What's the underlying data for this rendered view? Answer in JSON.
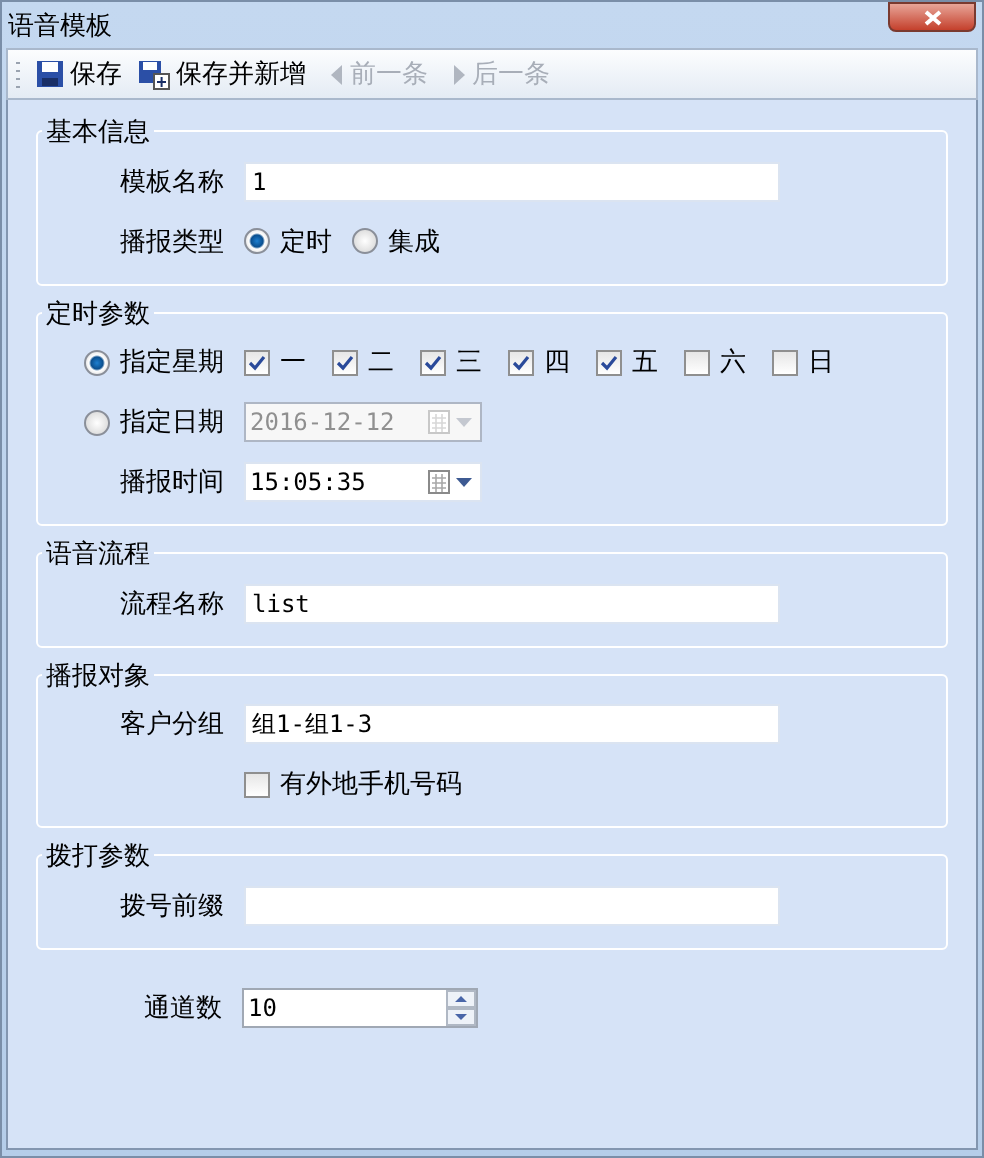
{
  "window": {
    "title": "语音模板"
  },
  "toolbar": [
    {
      "label": "保存",
      "kind": "save",
      "disabled": false
    },
    {
      "label": "保存并新增",
      "kind": "save-new",
      "disabled": false
    },
    {
      "label": "前一条",
      "kind": "prev",
      "disabled": true
    },
    {
      "label": "后一条",
      "kind": "next",
      "disabled": true
    }
  ],
  "groups": [
    {
      "title": "基本信息",
      "rows": [
        {
          "kind": "text",
          "label": "模板名称",
          "value": "1"
        },
        {
          "kind": "radio",
          "label": "播报类型",
          "options": [
            {
              "label": "定时",
              "selected": true
            },
            {
              "label": "集成",
              "selected": false
            }
          ]
        }
      ]
    },
    {
      "title": "定时参数",
      "rows": [
        {
          "kind": "weekdays",
          "label": "指定星期",
          "selected": true,
          "days": [
            {
              "label": "一",
              "checked": true
            },
            {
              "label": "二",
              "checked": true
            },
            {
              "label": "三",
              "checked": true
            },
            {
              "label": "四",
              "checked": true
            },
            {
              "label": "五",
              "checked": true
            },
            {
              "label": "六",
              "checked": false
            },
            {
              "label": "日",
              "checked": false
            }
          ]
        },
        {
          "kind": "date",
          "label": "指定日期",
          "selected": false,
          "value": "2016-12-12",
          "disabled": true
        },
        {
          "kind": "time",
          "label": "播报时间",
          "value": "15:05:35",
          "disabled": false
        }
      ]
    },
    {
      "title": "语音流程",
      "rows": [
        {
          "kind": "text",
          "label": "流程名称",
          "value": "list"
        }
      ]
    },
    {
      "title": "播报对象",
      "rows": [
        {
          "kind": "text",
          "label": "客户分组",
          "value": "组1-组1-3"
        },
        {
          "kind": "checkbox",
          "label": "有外地手机号码",
          "checked": false
        }
      ]
    },
    {
      "title": "拨打参数",
      "rows": [
        {
          "kind": "text",
          "label": "拨号前缀"
        }
      ]
    }
  ],
  "channels": {
    "label": "通道数",
    "value": "10"
  }
}
